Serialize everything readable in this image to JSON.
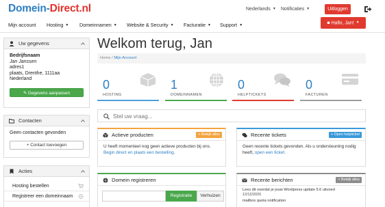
{
  "header": {
    "logo_part1": "Domein-",
    "logo_part2": "Direct.nl",
    "language": "Nederlands",
    "notifications": "Notificaties",
    "logout": "Uitloggen",
    "exit_icon": "sign-out-icon"
  },
  "nav": {
    "items": [
      "Mijn account",
      "Hosting",
      "Domeinnamen",
      "Website & Security",
      "Facturatie",
      "Support"
    ],
    "user_button": "Hallo, Jan!"
  },
  "sidebar": {
    "user_panel": {
      "title": "Uw gegevens",
      "company": "Bedrijfsnaam",
      "name": "Jan Janssen",
      "address": "adres1",
      "city": "plaats, Drenthe, 1111aa",
      "country": "Nederland",
      "button": "Gegevens aanpassen"
    },
    "contacts_panel": {
      "title": "Contacten",
      "empty_text": "Geen contacten gevonden",
      "button": "+ Contact toevoegen"
    },
    "actions_panel": {
      "title": "Acties",
      "items": [
        "Hosting bestellen",
        "Registreer een domeinnaam"
      ]
    }
  },
  "main": {
    "welcome": "Welkom terug, Jan",
    "breadcrumb": [
      "Home",
      "Mijn Account"
    ],
    "tiles": [
      {
        "count": "0",
        "label": "HOSTING",
        "color": "#4a9fdc",
        "icon": "box-icon"
      },
      {
        "count": "1",
        "label": "DOMEINNAMEN",
        "color": "#4aa84b",
        "icon": "globe-icon"
      },
      {
        "count": "0",
        "label": "HELPTICKETS",
        "color": "#e03a2f",
        "icon": "chat-icon"
      },
      {
        "count": "0",
        "label": "FACTUREN",
        "color": "#9b9b9b",
        "icon": "credit-card-icon"
      }
    ],
    "search_placeholder": "Stel uw vraag...",
    "products": {
      "title": "Actieve producten",
      "button": "+ Bekijk alles",
      "text_before": "U heeft momenteel nog geen actieve producten bij ons.",
      "link": "Begin direct en plaats een bestelling."
    },
    "tickets": {
      "title": "Recente tickets",
      "button": "+ Open helpticket",
      "text_before": "Geen recente tickets gevonden. Als u ondersteuning nodig heeft,",
      "link": "open een ticket."
    },
    "domain_register": {
      "title": "Domein registreren",
      "register_button": "Registratie",
      "transfer_button": "Verhuizen"
    },
    "messages": {
      "title": "Recente berichten",
      "button": "Bekijk alles",
      "items": [
        {
          "subject": "Lees dit voordat je jouw Wordpress update 5.6 uitvoert",
          "date": "12/12/2020"
        },
        {
          "subject": "mailbox quota notification",
          "date": ""
        }
      ]
    }
  },
  "colors": {
    "brand_blue": "#2e7fc3",
    "brand_red": "#e03a2f",
    "green": "#4aa84b",
    "orange": "#f3a440"
  }
}
